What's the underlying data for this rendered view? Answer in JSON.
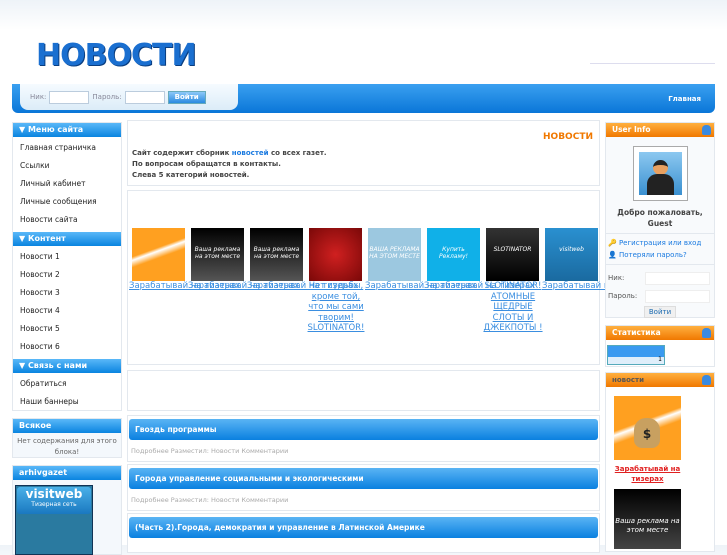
{
  "site": {
    "logo": "НОВОСТИ",
    "nav_home": "Главная"
  },
  "login": {
    "nick_label": "Ник:",
    "pass_label": "Пароль:",
    "submit": "Войти"
  },
  "left": {
    "menu_title": "▼ Меню сайта",
    "menu": [
      "Главная страничка",
      "Ссылки",
      "Личный кабинет",
      "Личные сообщения",
      "Новости сайта"
    ],
    "content_title": "▼ Контент",
    "content": [
      "Новости 1",
      "Новости 2",
      "Новости 3",
      "Новости 4",
      "Новости 5",
      "Новости 6"
    ],
    "contact_title": "▼ Связь с нами",
    "contact": [
      "Обратиться",
      "Наши баннеры"
    ],
    "misc_title": "Всякое",
    "misc_text": "Нет содержания для этого блока!",
    "archive_title": "arhivgazet",
    "archive_banner": "visitweb",
    "archive_banner_sub": "Тизерная сеть"
  },
  "center": {
    "title": "НОВОСТИ",
    "intro_pre": "Сайт содержит сборник ",
    "intro_link": "новостей",
    "intro_post": " со всех газет.",
    "line2": "По вопросам обращатся в контакты.",
    "line3": "Слева 5 категорий новостей.",
    "teasers": [
      {
        "text": "Зарабатывай на тизерах",
        "img": "money-bag"
      },
      {
        "text": "Зарабатывай на тизерах",
        "img": "Ваша реклама на этом месте"
      },
      {
        "text": "Зарабатывай на тизерах",
        "img": "Ваша реклама на этом месте"
      },
      {
        "text": "Нет судьбы, кроме той, что мы сами творим! SLOTINATOR!",
        "img": "red"
      },
      {
        "text": "Зарабатывай на тизерах",
        "img": "ВАША РЕКЛАМА НА ЭТОМ МЕСТЕ"
      },
      {
        "text": "Зарабатывай на тизерах",
        "img": "Купить Рекламу!"
      },
      {
        "text": "SLOTINATOR! АТОМНЫЕ ЩЕДРЫЕ СЛОТЫ И ДЖЕКПОТЫ !",
        "img": "SLOTINATOR"
      },
      {
        "text": "Зарабатывай на тизерах",
        "img": "visitweb"
      }
    ],
    "news": [
      {
        "title": "Гвоздь программы",
        "meta": "Подробнее Разместил: Новости Комментарии"
      },
      {
        "title": "Города управление социальными и экологическими",
        "meta": "Подробнее Разместил: Новости Комментарии"
      },
      {
        "title": "(Часть 2).Города, демократия и управление в Латинской Америке"
      }
    ]
  },
  "right": {
    "userinfo_title": "User Info",
    "welcome": "Добро пожаловать,",
    "user": "Guest",
    "register": "Регистрация или вход",
    "lost_pass": "Потеряли пароль?",
    "nick_label": "Ник:",
    "pass_label": "Пароль:",
    "submit": "Войти",
    "stats_title": "Статистика",
    "counter_value": "1",
    "news_title": "новости",
    "ad_text": "Зарабатывай на тизерах",
    "ad2_img": "Ваша реклама на этом месте"
  },
  "colors": {
    "blue": "#0a80e0",
    "orange": "#f07800",
    "link": "#3a8ee0"
  }
}
